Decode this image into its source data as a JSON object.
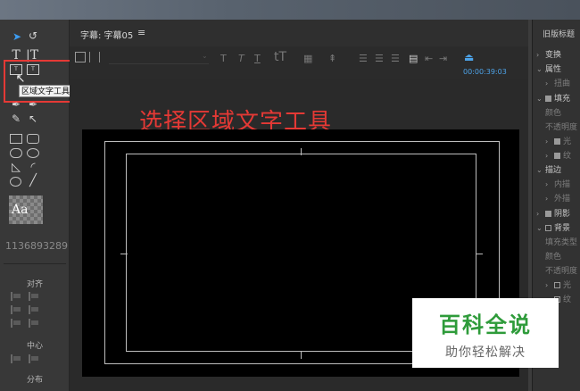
{
  "panel": {
    "title": "字幕: 字幕05",
    "menu_icon": "≡",
    "timecode": "00:00:39:03"
  },
  "tools": {
    "tooltip": "区域文字工具",
    "style_swatch": "Aa",
    "sample_id": "1136893289",
    "sections": {
      "align": "对齐",
      "center": "中心",
      "distribute": "分布"
    }
  },
  "annotation": "选择区域文字工具",
  "properties": {
    "header": "旧版标题",
    "items": [
      {
        "label": "变换",
        "arrow": "›"
      },
      {
        "label": "属性",
        "arrow": "⌄"
      },
      {
        "label": "扭曲",
        "arrow": "›"
      },
      {
        "label": "填充",
        "arrow": "⌄"
      },
      {
        "label": "颜色",
        "arrow": ""
      },
      {
        "label": "不透明度",
        "arrow": ""
      },
      {
        "label": "光",
        "arrow": "›"
      },
      {
        "label": "纹",
        "arrow": "›"
      },
      {
        "label": "描边",
        "arrow": "⌄"
      },
      {
        "label": "内描",
        "arrow": "›"
      },
      {
        "label": "外描",
        "arrow": "›"
      },
      {
        "label": "阴影",
        "arrow": "›"
      },
      {
        "label": "背景",
        "arrow": "⌄"
      },
      {
        "label": "填充类型",
        "arrow": ""
      },
      {
        "label": "颜色",
        "arrow": ""
      },
      {
        "label": "不透明度",
        "arrow": ""
      },
      {
        "label": "光",
        "arrow": "›"
      },
      {
        "label": "纹",
        "arrow": "›"
      }
    ]
  },
  "watermark": {
    "title": "百科全说",
    "subtitle": "助你轻松解决"
  },
  "colors": {
    "accent": "#4da3e8",
    "annotation": "#e53935",
    "watermark_green": "#2e9b3a"
  }
}
